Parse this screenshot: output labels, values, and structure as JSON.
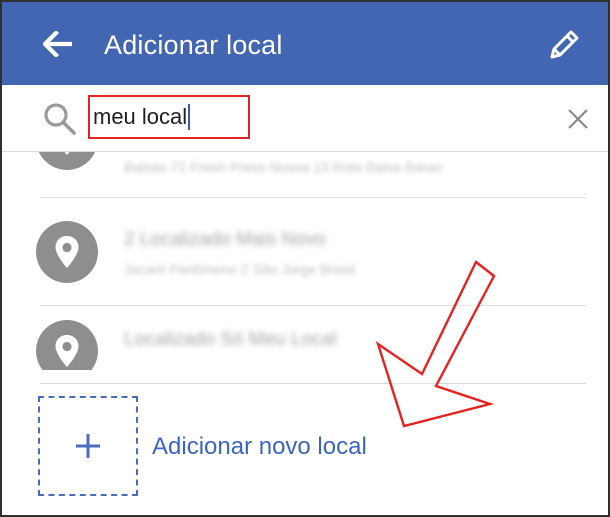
{
  "topbar": {
    "title": "Adicionar local",
    "back_icon": "arrow-left-icon",
    "edit_icon": "pencil-icon",
    "background_color": "#4266b2"
  },
  "search": {
    "value": "meu local",
    "search_icon": "search-icon",
    "clear_icon": "close-icon",
    "highlight_color": "#e52222"
  },
  "results": [
    {
      "name": "",
      "address": "Balsas-71 Fresh Press Nossa 13 Rota Balsa Barao",
      "icon": "location-pin-icon"
    },
    {
      "name": "2 Localizado Mais Novo",
      "address": "Jacaré Fenômeno 2 São Jorge Brasil",
      "icon": "location-pin-icon"
    },
    {
      "name": "Localizado Só Meu Local",
      "address": "",
      "icon": "location-pin-icon"
    }
  ],
  "add_place": {
    "label": "Adicionar novo local",
    "icon": "plus-icon",
    "accent_color": "#3b64c4"
  },
  "annotation": {
    "arrow_color": "#e52222"
  }
}
